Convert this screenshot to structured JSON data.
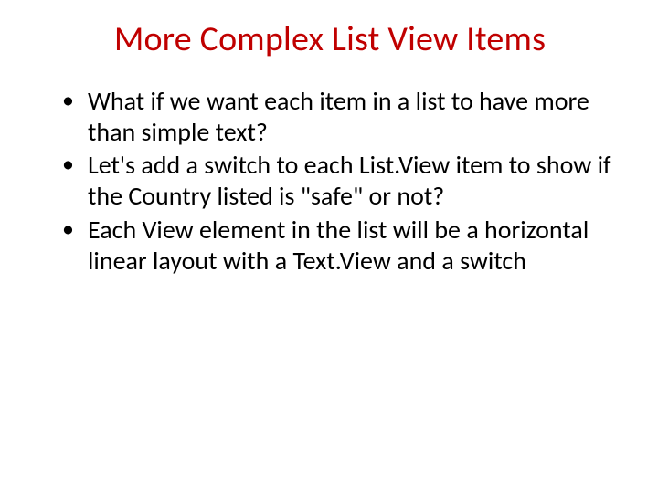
{
  "slide": {
    "title": "More Complex List View Items",
    "bullets": [
      "What if we want each item in a list to have more than simple text?",
      "Let's add a switch to each List.View item to show if the Country listed is \"safe\" or not?",
      "Each View element in the list will be a horizontal linear layout with a Text.View and a switch"
    ]
  }
}
